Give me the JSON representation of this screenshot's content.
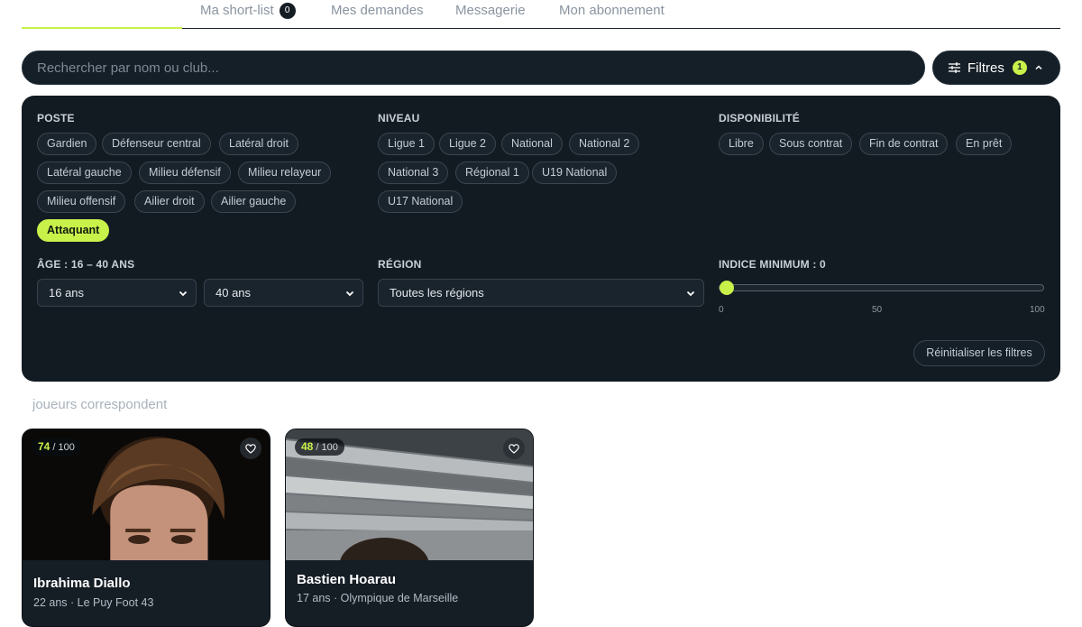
{
  "tabs": [
    {
      "label": "Ma short-list",
      "badge": "0"
    },
    {
      "label": "Mes demandes"
    },
    {
      "label": "Messagerie"
    },
    {
      "label": "Mon abonnement"
    }
  ],
  "search": {
    "placeholder": "Rechercher par nom ou club..."
  },
  "filters_button": {
    "label": "Filtres",
    "count": "1",
    "icon": "sliders-icon",
    "chevron": "chevron-up-icon"
  },
  "filters": {
    "poste": {
      "title": "POSTE",
      "options": [
        "Gardien",
        "Défenseur central",
        "Latéral droit",
        "Latéral gauche",
        "Milieu défensif",
        "Milieu relayeur",
        "Milieu offensif",
        "Ailier droit",
        "Ailier gauche",
        "Attaquant"
      ],
      "selected": "Attaquant"
    },
    "niveau": {
      "title": "NIVEAU",
      "options": [
        "Ligue 1",
        "Ligue 2",
        "National",
        "National 2",
        "National 3",
        "Régional 1",
        "U19 National",
        "U17 National"
      ]
    },
    "disponibilite": {
      "title": "DISPONIBILITÉ",
      "options": [
        "Libre",
        "Sous contrat",
        "Fin de contrat",
        "En prêt"
      ]
    },
    "age": {
      "title": "ÂGE : 16 – 40 ANS",
      "min_value": "16 ans",
      "max_value": "40 ans"
    },
    "region": {
      "title": "RÉGION",
      "value": "Toutes les régions"
    },
    "indice": {
      "title": "INDICE MINIMUM : 0",
      "value": 0,
      "min": 0,
      "max": 100,
      "ticks": [
        "0",
        "50",
        "100"
      ]
    },
    "reset_label": "Réinitialiser les filtres"
  },
  "results": {
    "count_label": "joueurs correspondent"
  },
  "players": [
    {
      "score": "74",
      "score_max": "/ 100",
      "name": "Ibrahima Diallo",
      "meta": "22 ans · Le Puy Foot 43"
    },
    {
      "score": "48",
      "score_max": "/ 100",
      "name": "Bastien Hoarau",
      "meta": "17 ans · Olympique de Marseille"
    }
  ],
  "colors": {
    "accent": "#c8f14a",
    "panel": "#131b22",
    "chip_border": "#3a4550"
  }
}
